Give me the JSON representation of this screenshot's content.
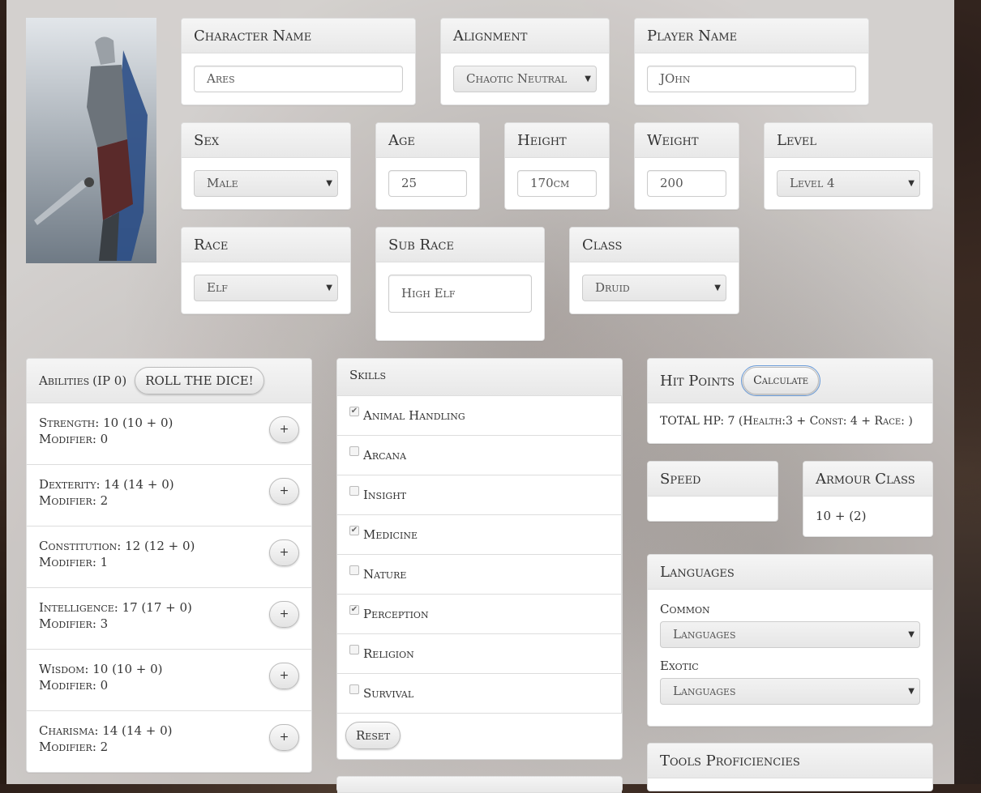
{
  "character": {
    "name": {
      "label": "Character Name",
      "value": "Ares"
    },
    "alignment": {
      "label": "Alignment",
      "value": "Chaotic Neutral"
    },
    "player": {
      "label": "Player Name",
      "value": "JOhn"
    },
    "sex": {
      "label": "Sex",
      "value": "Male"
    },
    "age": {
      "label": "Age",
      "value": "25"
    },
    "height": {
      "label": "Height",
      "value": "170cm"
    },
    "weight": {
      "label": "Weight",
      "value": "200"
    },
    "level": {
      "label": "Level",
      "value": "Level 4"
    },
    "race": {
      "label": "Race",
      "value": "Elf"
    },
    "subrace": {
      "label": "Sub Race",
      "value": "High Elf"
    },
    "class": {
      "label": "Class",
      "value": "Druid"
    }
  },
  "abilities": {
    "title": "Abilities",
    "ip": "(IP 0)",
    "roll_button": "ROLL THE DICE!",
    "plus_label": "+",
    "items": [
      {
        "line": "Strength: 10 (10 + 0)",
        "modifier": "Modifier: 0"
      },
      {
        "line": "Dexterity: 14 (14 + 0)",
        "modifier": "Modifier: 2"
      },
      {
        "line": "Constitution: 12 (12 + 0)",
        "modifier": "Modifier: 1"
      },
      {
        "line": "Intelligence: 17 (17 + 0)",
        "modifier": "Modifier: 3"
      },
      {
        "line": "Wisdom: 10 (10 + 0)",
        "modifier": "Modifier: 0"
      },
      {
        "line": "Charisma: 14 (14 + 0)",
        "modifier": "Modifier: 2"
      }
    ]
  },
  "skills": {
    "title": "Skills",
    "reset_button": "Reset",
    "items": [
      {
        "name": "Animal Handling",
        "checked": true
      },
      {
        "name": "Arcana",
        "checked": false
      },
      {
        "name": "Insight",
        "checked": false
      },
      {
        "name": "Medicine",
        "checked": true
      },
      {
        "name": "Nature",
        "checked": false
      },
      {
        "name": "Perception",
        "checked": true
      },
      {
        "name": "Religion",
        "checked": false
      },
      {
        "name": "Survival",
        "checked": false
      }
    ]
  },
  "hit_points": {
    "title": "Hit Points",
    "calc_button": "Calculate",
    "total": "TOTAL HP: 7 (Health:3 + Const: 4 + Race: )"
  },
  "speed": {
    "title": "Speed",
    "value": ""
  },
  "armour": {
    "title": "Armour Class",
    "value": "10 + (2)"
  },
  "languages": {
    "title": "Languages",
    "common_label": "Common",
    "common_value": "Languages",
    "exotic_label": "Exotic",
    "exotic_value": "Languages"
  },
  "tools": {
    "title": "Tools Proficiencies"
  },
  "icons": {
    "caret": "caret-down-icon",
    "check": "checkmark-icon"
  }
}
